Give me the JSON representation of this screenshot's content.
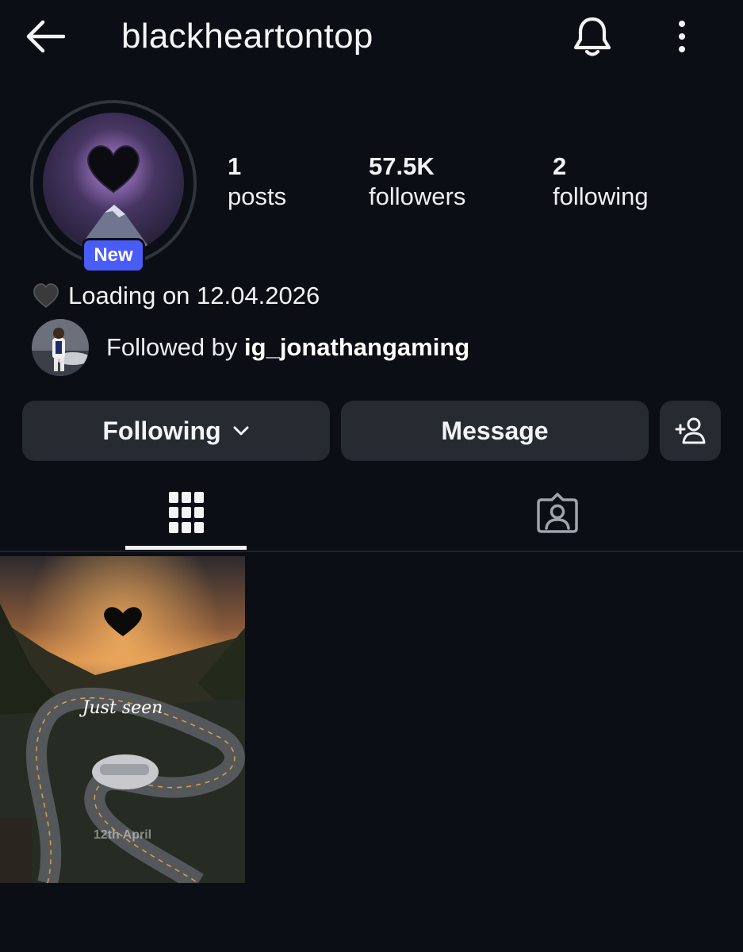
{
  "header": {
    "username": "blackheartontop",
    "icons": [
      "back-arrow-icon",
      "bell-icon",
      "more-vertical-icon"
    ]
  },
  "profile": {
    "badge": "New",
    "stats": {
      "posts_count": "1",
      "posts_label": "posts",
      "followers_count": "57.5K",
      "followers_label": "followers",
      "following_count": "2",
      "following_label": "following"
    },
    "bio_emoji": "black-heart",
    "bio_text": "Loading on 12.04.2026",
    "followed_by_prefix": "Followed by ",
    "followed_by_name": "ig_jonathangaming"
  },
  "actions": {
    "following_label": "Following",
    "message_label": "Message",
    "add_icon": "add-person-icon"
  },
  "tabs": {
    "active": "grid",
    "items": [
      "grid-icon",
      "tagged-icon"
    ]
  },
  "post": {
    "caption": "Just seen",
    "date": "12th April"
  },
  "colors": {
    "background": "#0b0e14",
    "button": "#262a31",
    "badge": "#4a5cf7",
    "text": "#f2f3f5"
  }
}
